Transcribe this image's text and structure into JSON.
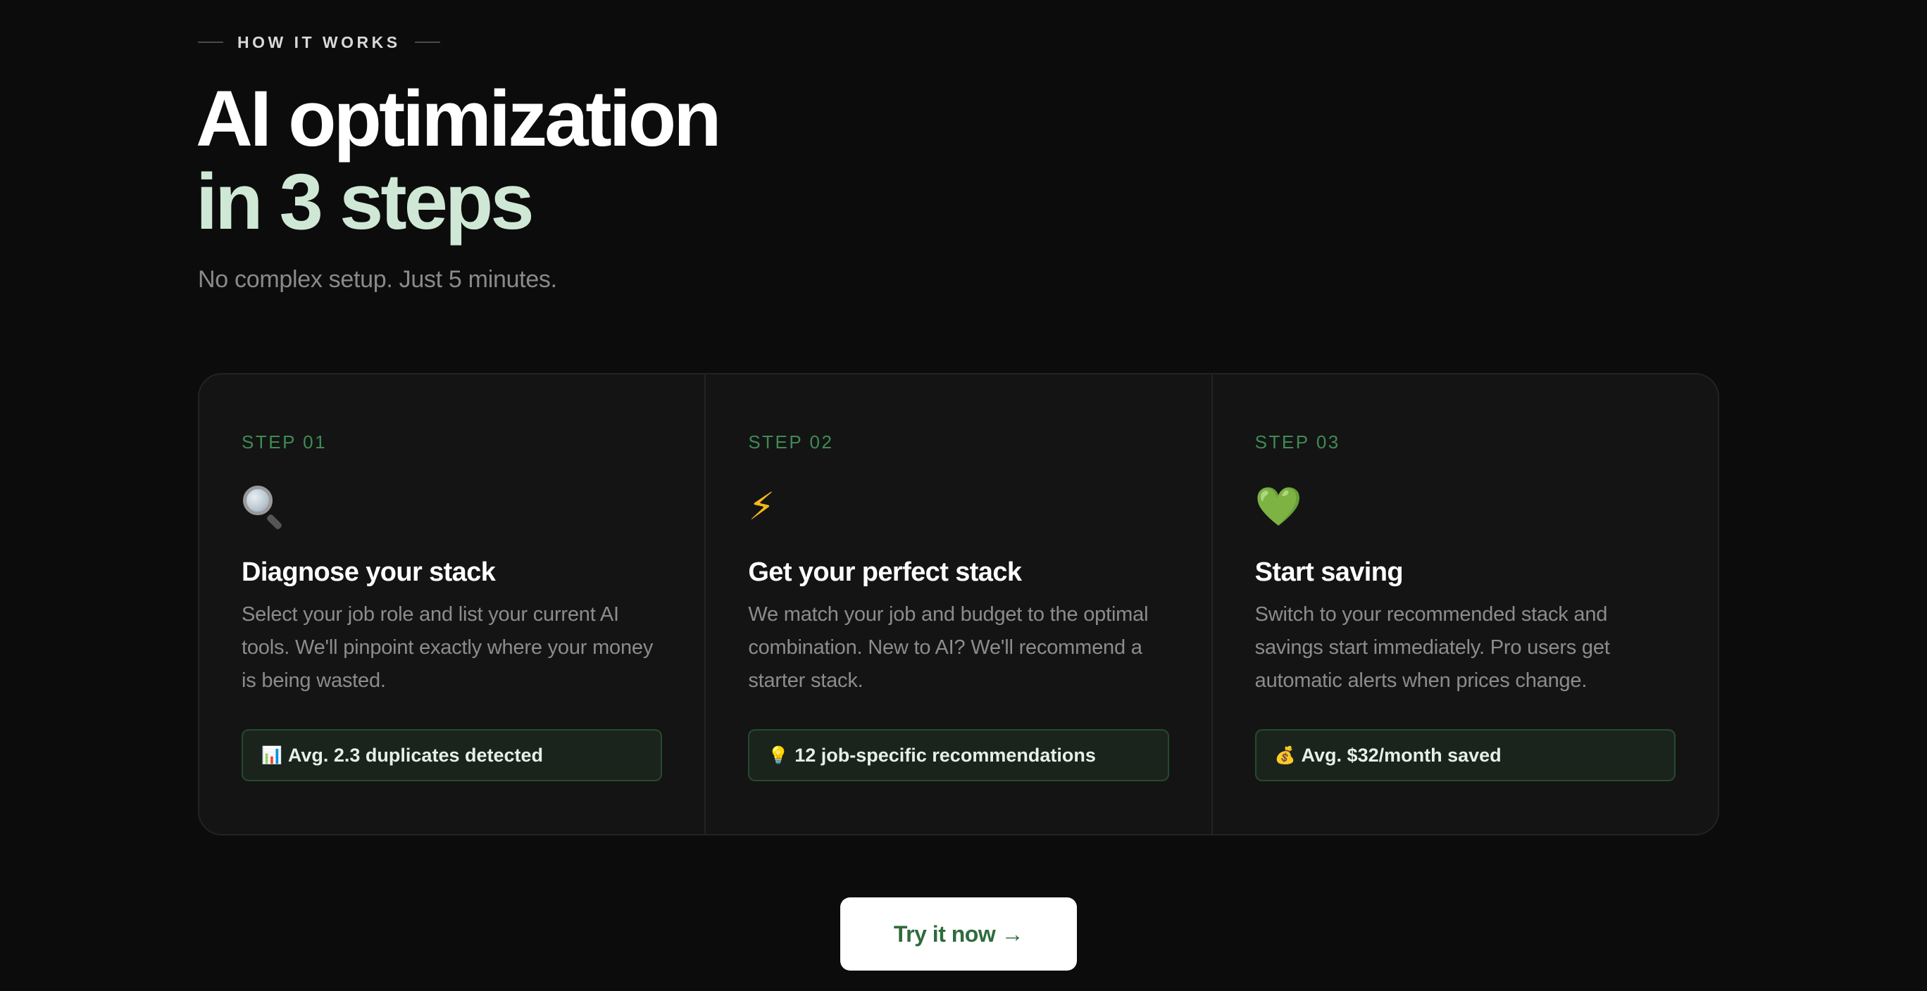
{
  "section": {
    "eyebrow": "HOW IT WORKS",
    "title_line1": "AI optimization",
    "title_line2": "in 3 steps",
    "subtitle": "No complex setup. Just 5 minutes."
  },
  "steps": [
    {
      "number": "STEP 01",
      "icon": "magnifier-icon",
      "title": "Diagnose your stack",
      "description": "Select your job role and list your current AI tools. We'll pinpoint exactly where your money is being wasted.",
      "badge_icon": "📊",
      "badge": "Avg. 2.3 duplicates detected"
    },
    {
      "number": "STEP 02",
      "icon": "lightning-icon",
      "icon_glyph": "⚡",
      "title": "Get your perfect stack",
      "description": "We match your job and budget to the optimal combination. New to AI? We'll recommend a starter stack.",
      "badge_icon": "💡",
      "badge": "12 job-specific recommendations"
    },
    {
      "number": "STEP 03",
      "icon": "green-heart-icon",
      "icon_glyph": "💚",
      "title": "Start saving",
      "description": "Switch to your recommended stack and savings start immediately. Pro users get automatic alerts when prices change.",
      "badge_icon": "💰",
      "badge": "Avg. $32/month saved"
    }
  ],
  "cta": {
    "label": "Try it now →"
  },
  "colors": {
    "background": "#0c0c0c",
    "accent_green": "#3f8a55",
    "title_mint": "#cfe8d6",
    "cta_text": "#2f6b3d"
  }
}
